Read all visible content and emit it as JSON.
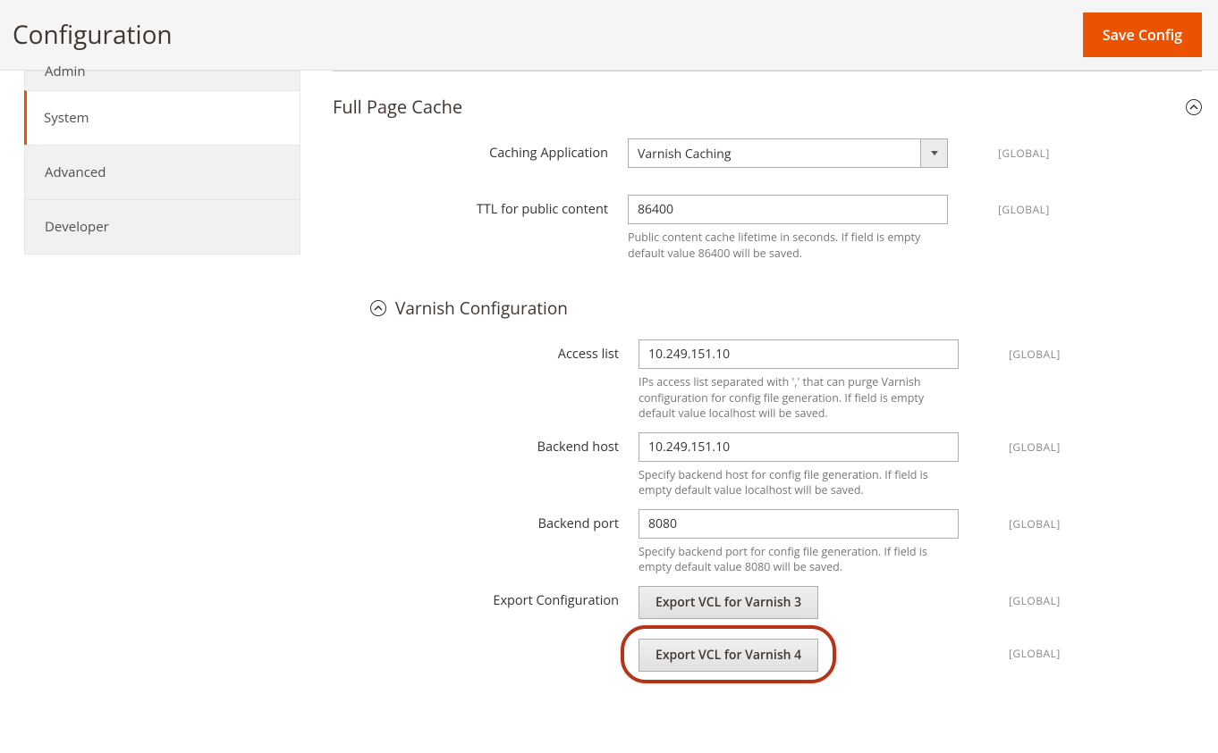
{
  "header": {
    "title": "Configuration",
    "save_button": "Save Config"
  },
  "sidebar": {
    "items": [
      {
        "label": "Admin"
      },
      {
        "label": "System"
      },
      {
        "label": "Advanced"
      },
      {
        "label": "Developer"
      }
    ]
  },
  "scope_label": "[GLOBAL]",
  "section": {
    "title": "Full Page Cache",
    "fields": {
      "caching_app": {
        "label": "Caching Application",
        "value": "Varnish Caching"
      },
      "ttl": {
        "label": "TTL for public content",
        "value": "86400",
        "note": "Public content cache lifetime in seconds. If field is empty default value 86400 will be saved."
      }
    }
  },
  "subsection": {
    "title": "Varnish Configuration",
    "fields": {
      "access_list": {
        "label": "Access list",
        "value": "10.249.151.10",
        "note": "IPs access list separated with ',' that can purge Varnish configuration for config file generation. If field is empty default value localhost will be saved."
      },
      "backend_host": {
        "label": "Backend host",
        "value": "10.249.151.10",
        "note": "Specify backend host for config file generation. If field is empty default value localhost will be saved."
      },
      "backend_port": {
        "label": "Backend port",
        "value": "8080",
        "note": "Specify backend port for config file generation. If field is empty default value 8080 will be saved."
      },
      "export": {
        "label": "Export Configuration",
        "btn_v3": "Export VCL for Varnish 3",
        "btn_v4": "Export VCL for Varnish 4"
      }
    }
  }
}
